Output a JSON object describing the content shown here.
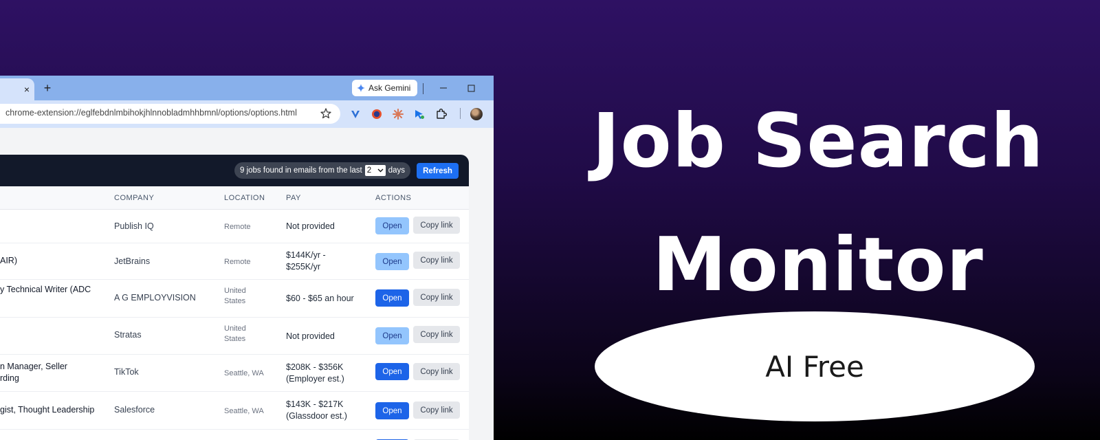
{
  "browser": {
    "tab_close_glyph": "×",
    "new_tab_glyph": "+",
    "gemini_label": "Ask Gemini",
    "url": "chrome-extension://eglfebdnlmbihokjhlnnobladmhhbmnl/options/options.html",
    "icons": [
      "star-icon",
      "extension-v-icon",
      "extension-firefox-icon",
      "extension-asterisk-icon",
      "extension-arrow-icon",
      "puzzle-icon",
      "avatar"
    ]
  },
  "header": {
    "jobs_found_text": "9 jobs found in emails from the last",
    "days_value": "2",
    "days_suffix": "days",
    "refresh_label": "Refresh"
  },
  "table": {
    "columns": [
      "COMPANY",
      "LOCATION",
      "PAY",
      "ACTIONS"
    ],
    "open_label": "Open",
    "copy_label": "Copy link",
    "rows": [
      {
        "title": "",
        "company": "Publish IQ",
        "location": "Remote",
        "pay": "Not provided"
      },
      {
        "title": "AIR)",
        "company": "JetBrains",
        "location": "Remote",
        "pay": "$144K/yr - $255K/yr"
      },
      {
        "title": "y Technical Writer (ADC",
        "company": "A G EMPLOYVISION",
        "location": "United States",
        "pay": "$60 - $65 an hour"
      },
      {
        "title": "",
        "company": "Stratas",
        "location": "United States",
        "pay": "Not provided"
      },
      {
        "title": "n Manager, Seller rding",
        "company": "TikTok",
        "location": "Seattle, WA",
        "pay": "$208K - $356K (Employer est.)"
      },
      {
        "title": "gist, Thought Leadership",
        "company": "Salesforce",
        "location": "Seattle, WA",
        "pay": "$143K - $217K (Glassdoor est.)"
      }
    ]
  },
  "promo": {
    "line1": "Job Search",
    "line2": "Monitor",
    "badge": "AI Free"
  },
  "colors": {
    "bg_top": "#2e1163",
    "bg_bottom": "#000000",
    "accent": "#1d6ff2",
    "header_dark": "#12192a"
  }
}
